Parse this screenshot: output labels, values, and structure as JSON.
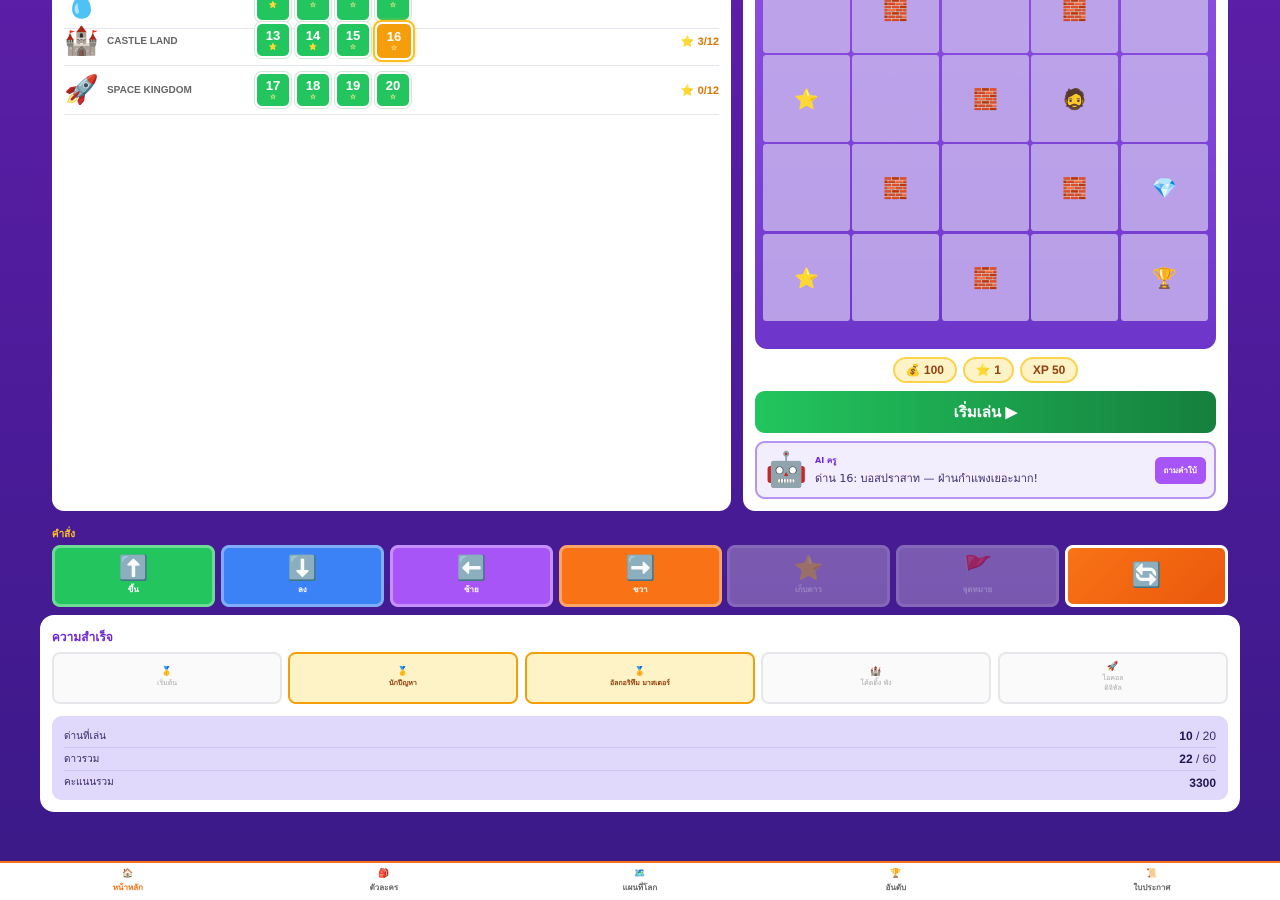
{
  "worlds": [
    {
      "icon": "💧",
      "name": "",
      "levels": [
        {
          "num": "",
          "star": "⭐"
        },
        {
          "num": "",
          "star": "☆"
        },
        {
          "num": "",
          "star": "☆"
        },
        {
          "num": "",
          "star": "☆"
        }
      ],
      "stars": ""
    },
    {
      "icon": "🏰",
      "name": "CASTLE LAND",
      "levels": [
        {
          "num": "13",
          "star": "⭐"
        },
        {
          "num": "14",
          "star": "⭐"
        },
        {
          "num": "15",
          "star": "☆"
        },
        {
          "num": "16",
          "star": "☆",
          "current": true
        }
      ],
      "stars": "⭐ 3/12"
    },
    {
      "icon": "🚀",
      "name": "SPACE KINGDOM",
      "levels": [
        {
          "num": "17",
          "star": "☆"
        },
        {
          "num": "18",
          "star": "☆"
        },
        {
          "num": "19",
          "star": "☆"
        },
        {
          "num": "20",
          "star": "☆"
        }
      ],
      "stars": "⭐ 0/12"
    }
  ],
  "board": {
    "rows": [
      [
        "",
        "🧱",
        "",
        "🧱",
        ""
      ],
      [
        "⭐",
        "",
        "🧱",
        "🧔",
        ""
      ],
      [
        "",
        "🧱",
        "",
        "🧱",
        "💎"
      ],
      [
        "⭐",
        "",
        "🧱",
        "",
        "🏆"
      ]
    ]
  },
  "rewards": {
    "coins": "💰 100",
    "stars": "⭐ 1",
    "xp": "XP 50"
  },
  "play_button": "เริ่มเล่น ▶",
  "ai": {
    "icon": "🤖",
    "name": "AI ครู",
    "message": "ด่าน 16: บอสปราสาท — ฝ่านกำแพงเยอะมาก!",
    "ask_button": "ถามคำใบ้"
  },
  "commands": {
    "label": "คำสั่ง",
    "items": [
      {
        "icon": "⬆️",
        "label": "ขึ้น",
        "color": "#22c55e"
      },
      {
        "icon": "⬇️",
        "label": "ลง",
        "color": "#3b82f6"
      },
      {
        "icon": "⬅️",
        "label": "ซ้าย",
        "color": "#a855f7"
      },
      {
        "icon": "➡️",
        "label": "ขวา",
        "color": "#f97316"
      },
      {
        "icon": "⭐",
        "label": "เก็บดาว",
        "color": "#9b8ab8"
      },
      {
        "icon": "🚩",
        "label": "จุดหมาย",
        "color": "#9b8ab8"
      },
      {
        "icon": "🔄",
        "label": "",
        "color": "#f97316"
      }
    ]
  },
  "achievements": {
    "title": "ความสำเร็จ",
    "badges": [
      {
        "icon": "🥇",
        "label": "เริ่มต้น",
        "got": false
      },
      {
        "icon": "🥇",
        "label": "นักปีญหา",
        "got": true
      },
      {
        "icon": "🏅",
        "label": "อัลกอริทึม มาสเตอร์",
        "got": true
      },
      {
        "icon": "🏰",
        "label": "โค้ดติ้ง พัง",
        "got": false
      },
      {
        "icon": "🚀",
        "label": "ไอคอล ดิจิทัล",
        "got": false
      }
    ]
  },
  "stats": [
    {
      "label": "ด่านที่เล่น",
      "value": "10",
      "total": "/ 20"
    },
    {
      "label": "ดาวรวม",
      "value": "22",
      "total": "/ 60"
    },
    {
      "label": "คะแนนรวม",
      "value": "3300",
      "total": ""
    }
  ],
  "nav": [
    {
      "icon": "🏠",
      "label": "หน้าหลัก",
      "active": true
    },
    {
      "icon": "🎒",
      "label": "ตัวละคร",
      "active": false
    },
    {
      "icon": "🗺️",
      "label": "แผนที่โลก",
      "active": false
    },
    {
      "icon": "🏆",
      "label": "อันดับ",
      "active": false
    },
    {
      "icon": "📜",
      "label": "ใบประกาศ",
      "active": false
    }
  ]
}
